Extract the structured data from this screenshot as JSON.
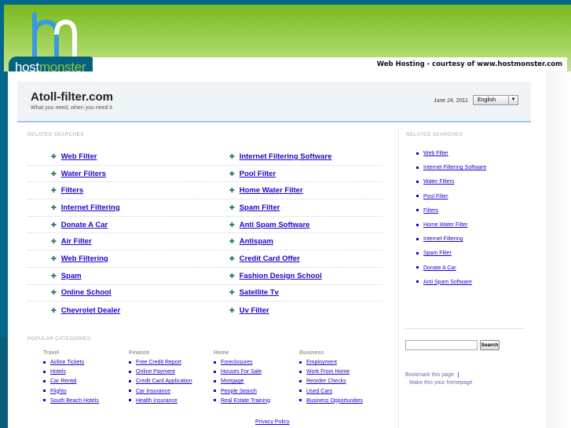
{
  "header": {
    "logo_text": "hostmonster",
    "courtesy": "Web Hosting - courtesy of www.hostmonster.com"
  },
  "site": {
    "title": "Atoll-filter.com",
    "tagline": "What you need, when you need it",
    "date": "June 24, 2011",
    "language": "English"
  },
  "main": {
    "heading": "RELATED SEARCHES",
    "rows": [
      [
        "Web Filter",
        "Internet Filtering Software"
      ],
      [
        "Water Filters",
        "Pool Filter"
      ],
      [
        "Filters",
        "Home Water Filter"
      ],
      [
        "Internet Filtering",
        "Spam Filter"
      ],
      [
        "Donate A Car",
        "Anti Spam Software"
      ],
      [
        "Air Filter",
        "Antispam"
      ],
      [
        "Web Filtering",
        "Credit Card Offer"
      ],
      [
        "Spam",
        "Fashion Design School"
      ],
      [
        "Online School",
        "Satellite Tv"
      ],
      [
        "Chevrolet Dealer",
        "Uv Filter"
      ]
    ]
  },
  "sidebar": {
    "heading": "RELATED SEARCHES",
    "items": [
      "Web Filter",
      "Internet Filtering Software",
      "Water Filters",
      "Pool Filter",
      "Filters",
      "Home Water Filter",
      "Internet Filtering",
      "Spam Filter",
      "Donate A Car",
      "Anti Spam Software"
    ],
    "search_button": "Search",
    "search_value": "",
    "bookmark": "Bookmark this page",
    "homepage": "Make this your homepage"
  },
  "categories": {
    "heading": "POPULAR CATEGORIES",
    "groups": [
      {
        "title": "Travel",
        "items": [
          "Airline Tickets",
          "Hotels",
          "Car Rental",
          "Flights",
          "South Beach Hotels"
        ]
      },
      {
        "title": "Finance",
        "items": [
          "Free Credit Report",
          "Online Payment",
          "Credit Card Application",
          "Car Insurance",
          "Health Insurance"
        ]
      },
      {
        "title": "Home",
        "items": [
          "Foreclosures",
          "Houses For Sale",
          "Mortgage",
          "People Search",
          "Real Estate Training"
        ]
      },
      {
        "title": "Business",
        "items": [
          "Employment",
          "Work From Home",
          "Reorder Checks",
          "Used Cars",
          "Business Opportunities"
        ]
      }
    ]
  },
  "footer": {
    "privacy": "Privacy Policy"
  },
  "colors": {
    "link": "#2200cc",
    "header_green": "#8cc63f",
    "brand_teal": "#06617e"
  }
}
